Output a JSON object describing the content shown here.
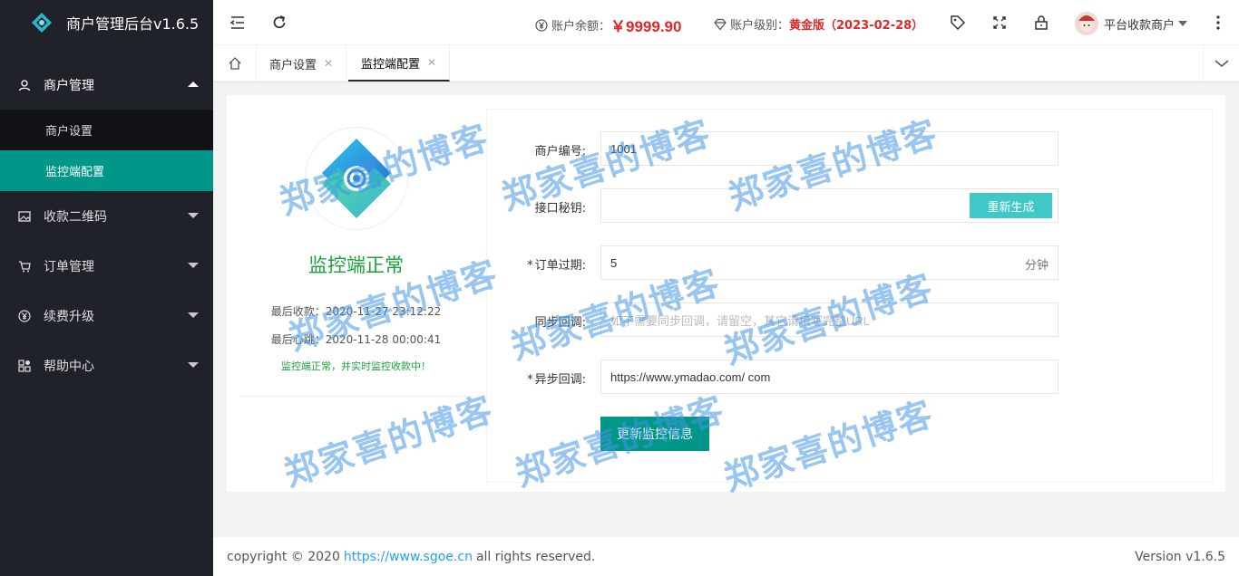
{
  "app": {
    "title": "商户管理后台v1.6.5"
  },
  "sidebar": {
    "items": [
      {
        "label": "商户管理",
        "icon": "user-icon"
      },
      {
        "label": "收款二维码",
        "icon": "image-icon"
      },
      {
        "label": "订单管理",
        "icon": "cart-icon"
      },
      {
        "label": "续费升级",
        "icon": "yen-icon"
      },
      {
        "label": "帮助中心",
        "icon": "apps-icon"
      }
    ],
    "sub_items": [
      {
        "label": "商户设置"
      },
      {
        "label": "监控端配置"
      }
    ]
  },
  "header": {
    "balance_label": "账户余额：",
    "balance_value": "￥9999.90",
    "level_label": "账户级别：",
    "level_value": "黄金版（2023-02-28）",
    "user_name": "平台收款商户"
  },
  "tabs": [
    {
      "label": "商户设置"
    },
    {
      "label": "监控端配置"
    }
  ],
  "status": {
    "title": "监控端正常",
    "last_payment": "最后收款：2020-11-27 23:12:22",
    "last_heartbeat": "最后心跳：2020-11-28 00:00:41",
    "message": "监控端正常，并实时监控收款中！"
  },
  "form": {
    "merchant_id_label": "商户编号:",
    "merchant_id_value": "1001",
    "secret_label": "接口秘钥:",
    "secret_value": "",
    "regen_label": "重新生成",
    "expire_label": "订单过期:",
    "expire_value": "5",
    "expire_unit": "分钟",
    "sync_label": "同步回调:",
    "sync_placeholder": "如不需要同步回调，请留空，其它请填写完整URL",
    "async_label": "异步回调:",
    "async_value": "https://www.ymadao.com/ com",
    "submit_label": "更新监控信息"
  },
  "watermark": {
    "text": "郑家喜的博客"
  },
  "footer": {
    "copyright": "copyright © 2020",
    "link": "https://www.sgoe.cn",
    "rights": "all rights reserved.",
    "version": "Version v1.6.5"
  },
  "colors": {
    "accent": "#009688",
    "sidebar": "#20222a",
    "danger": "#e02828",
    "success": "#1aa33a",
    "regen": "#3fc8c8"
  }
}
